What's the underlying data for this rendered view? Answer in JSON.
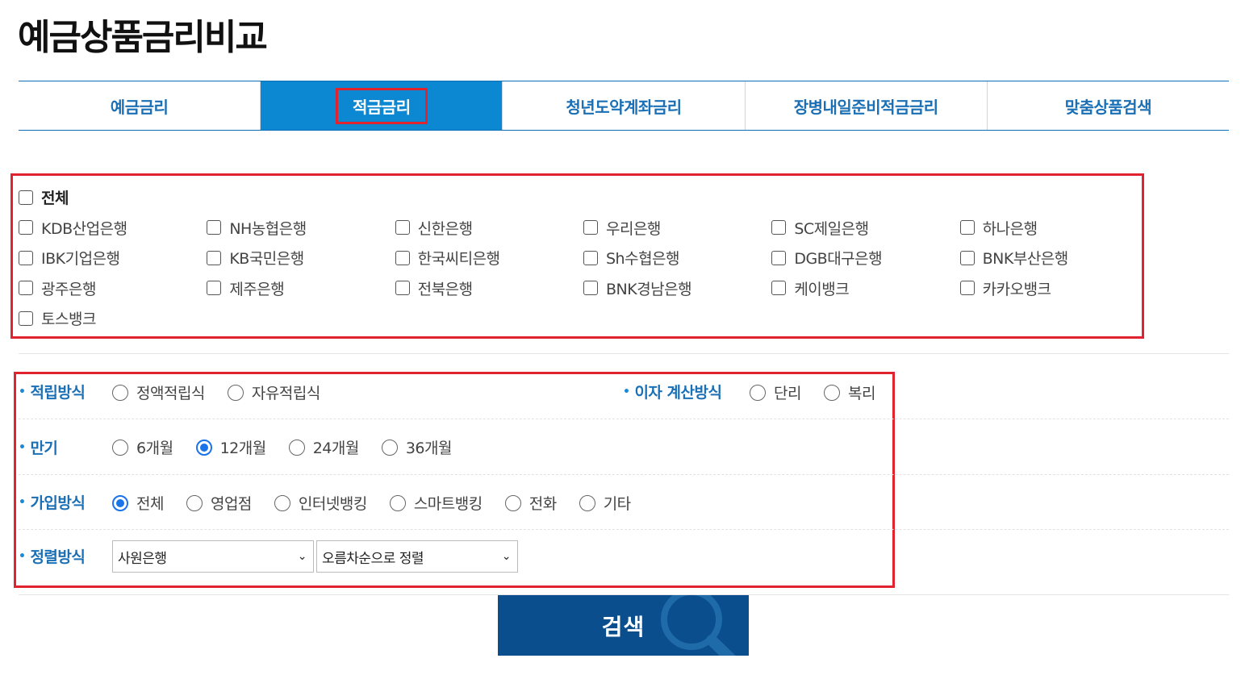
{
  "page": {
    "title": "예금상품금리비교"
  },
  "tabs": [
    {
      "label": "예금금리",
      "active": false
    },
    {
      "label": "적금금리",
      "active": true
    },
    {
      "label": "청년도약계좌금리",
      "active": false
    },
    {
      "label": "장병내일준비적금금리",
      "active": false
    },
    {
      "label": "맞춤상품검색",
      "active": false
    }
  ],
  "banks": {
    "all_label": "전체",
    "items": [
      "KDB산업은행",
      "NH농협은행",
      "신한은행",
      "우리은행",
      "SC제일은행",
      "하나은행",
      "IBK기업은행",
      "KB국민은행",
      "한국씨티은행",
      "Sh수협은행",
      "DGB대구은행",
      "BNK부산은행",
      "광주은행",
      "제주은행",
      "전북은행",
      "BNK경남은행",
      "케이뱅크",
      "카카오뱅크",
      "토스뱅크"
    ]
  },
  "options": {
    "saving_method": {
      "label": "적립방식",
      "choices": [
        "정액적립식",
        "자유적립식"
      ],
      "selected": null
    },
    "interest_method": {
      "label": "이자 계산방식",
      "choices": [
        "단리",
        "복리"
      ],
      "selected": null
    },
    "term": {
      "label": "만기",
      "choices": [
        "6개월",
        "12개월",
        "24개월",
        "36개월"
      ],
      "selected": "12개월"
    },
    "join_method": {
      "label": "가입방식",
      "choices": [
        "전체",
        "영업점",
        "인터넷뱅킹",
        "스마트뱅킹",
        "전화",
        "기타"
      ],
      "selected": "전체"
    },
    "sort": {
      "label": "정렬방식",
      "primary": "사원은행",
      "order": "오름차순으로 정렬"
    }
  },
  "search": {
    "label": "검색"
  },
  "colors": {
    "accent": "#0b88d1",
    "tab_text": "#1a6fb5",
    "highlight": "#e0232e",
    "button": "#0a4e8d"
  }
}
